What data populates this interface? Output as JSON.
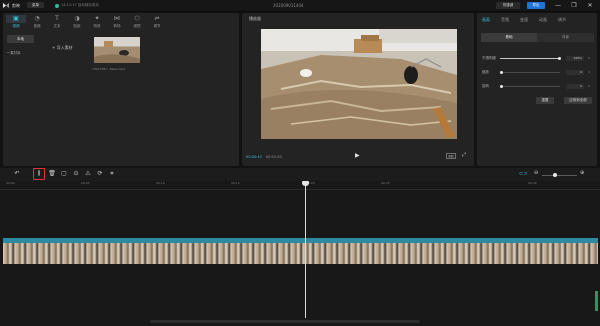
{
  "titlebar": {
    "app_name": "剪映",
    "menu_label": "菜单",
    "autosave": "14:12:17 自动保存成功",
    "project_title": "202009011404",
    "shortcut_label": "快捷键",
    "export_label": "导出",
    "window_controls": [
      "—",
      "❐",
      "✕"
    ]
  },
  "toolbar": {
    "items": [
      {
        "label": "视频",
        "icon": "video-icon"
      },
      {
        "label": "音频",
        "icon": "audio-icon"
      },
      {
        "label": "文本",
        "icon": "text-icon"
      },
      {
        "label": "贴纸",
        "icon": "sticker-icon"
      },
      {
        "label": "特效",
        "icon": "effects-icon"
      },
      {
        "label": "转场",
        "icon": "transition-icon"
      },
      {
        "label": "滤镜",
        "icon": "filter-icon"
      },
      {
        "label": "调节",
        "icon": "adjust-icon"
      }
    ]
  },
  "media": {
    "side_local": "本地",
    "side_material": "• 素材库",
    "import_label": "导入素材",
    "clip_name": "c7bb77ffc...5abe.mp4"
  },
  "player": {
    "title": "播放器",
    "time_current": "00:00:40",
    "time_total": "00:01:20",
    "ratio": "原始"
  },
  "properties": {
    "tabs": [
      "画面",
      "音频",
      "变速",
      "动画",
      "调节"
    ],
    "seg_tabs": [
      "基础",
      "背景"
    ],
    "opacity_label": "不透明度",
    "opacity_value": "100%",
    "rotate_label": "缩放",
    "rotate_value": "0",
    "position_label": "旋转",
    "position_value": "0",
    "reset_label": "重置",
    "apply_all_label": "应用到全部"
  },
  "timeline": {
    "tooltip": "分割(Ctrl+B)",
    "ruler_labels": [
      "00:00",
      "00:05",
      "00:10",
      "00:15",
      "00:20",
      "00:25",
      "00:30"
    ]
  }
}
